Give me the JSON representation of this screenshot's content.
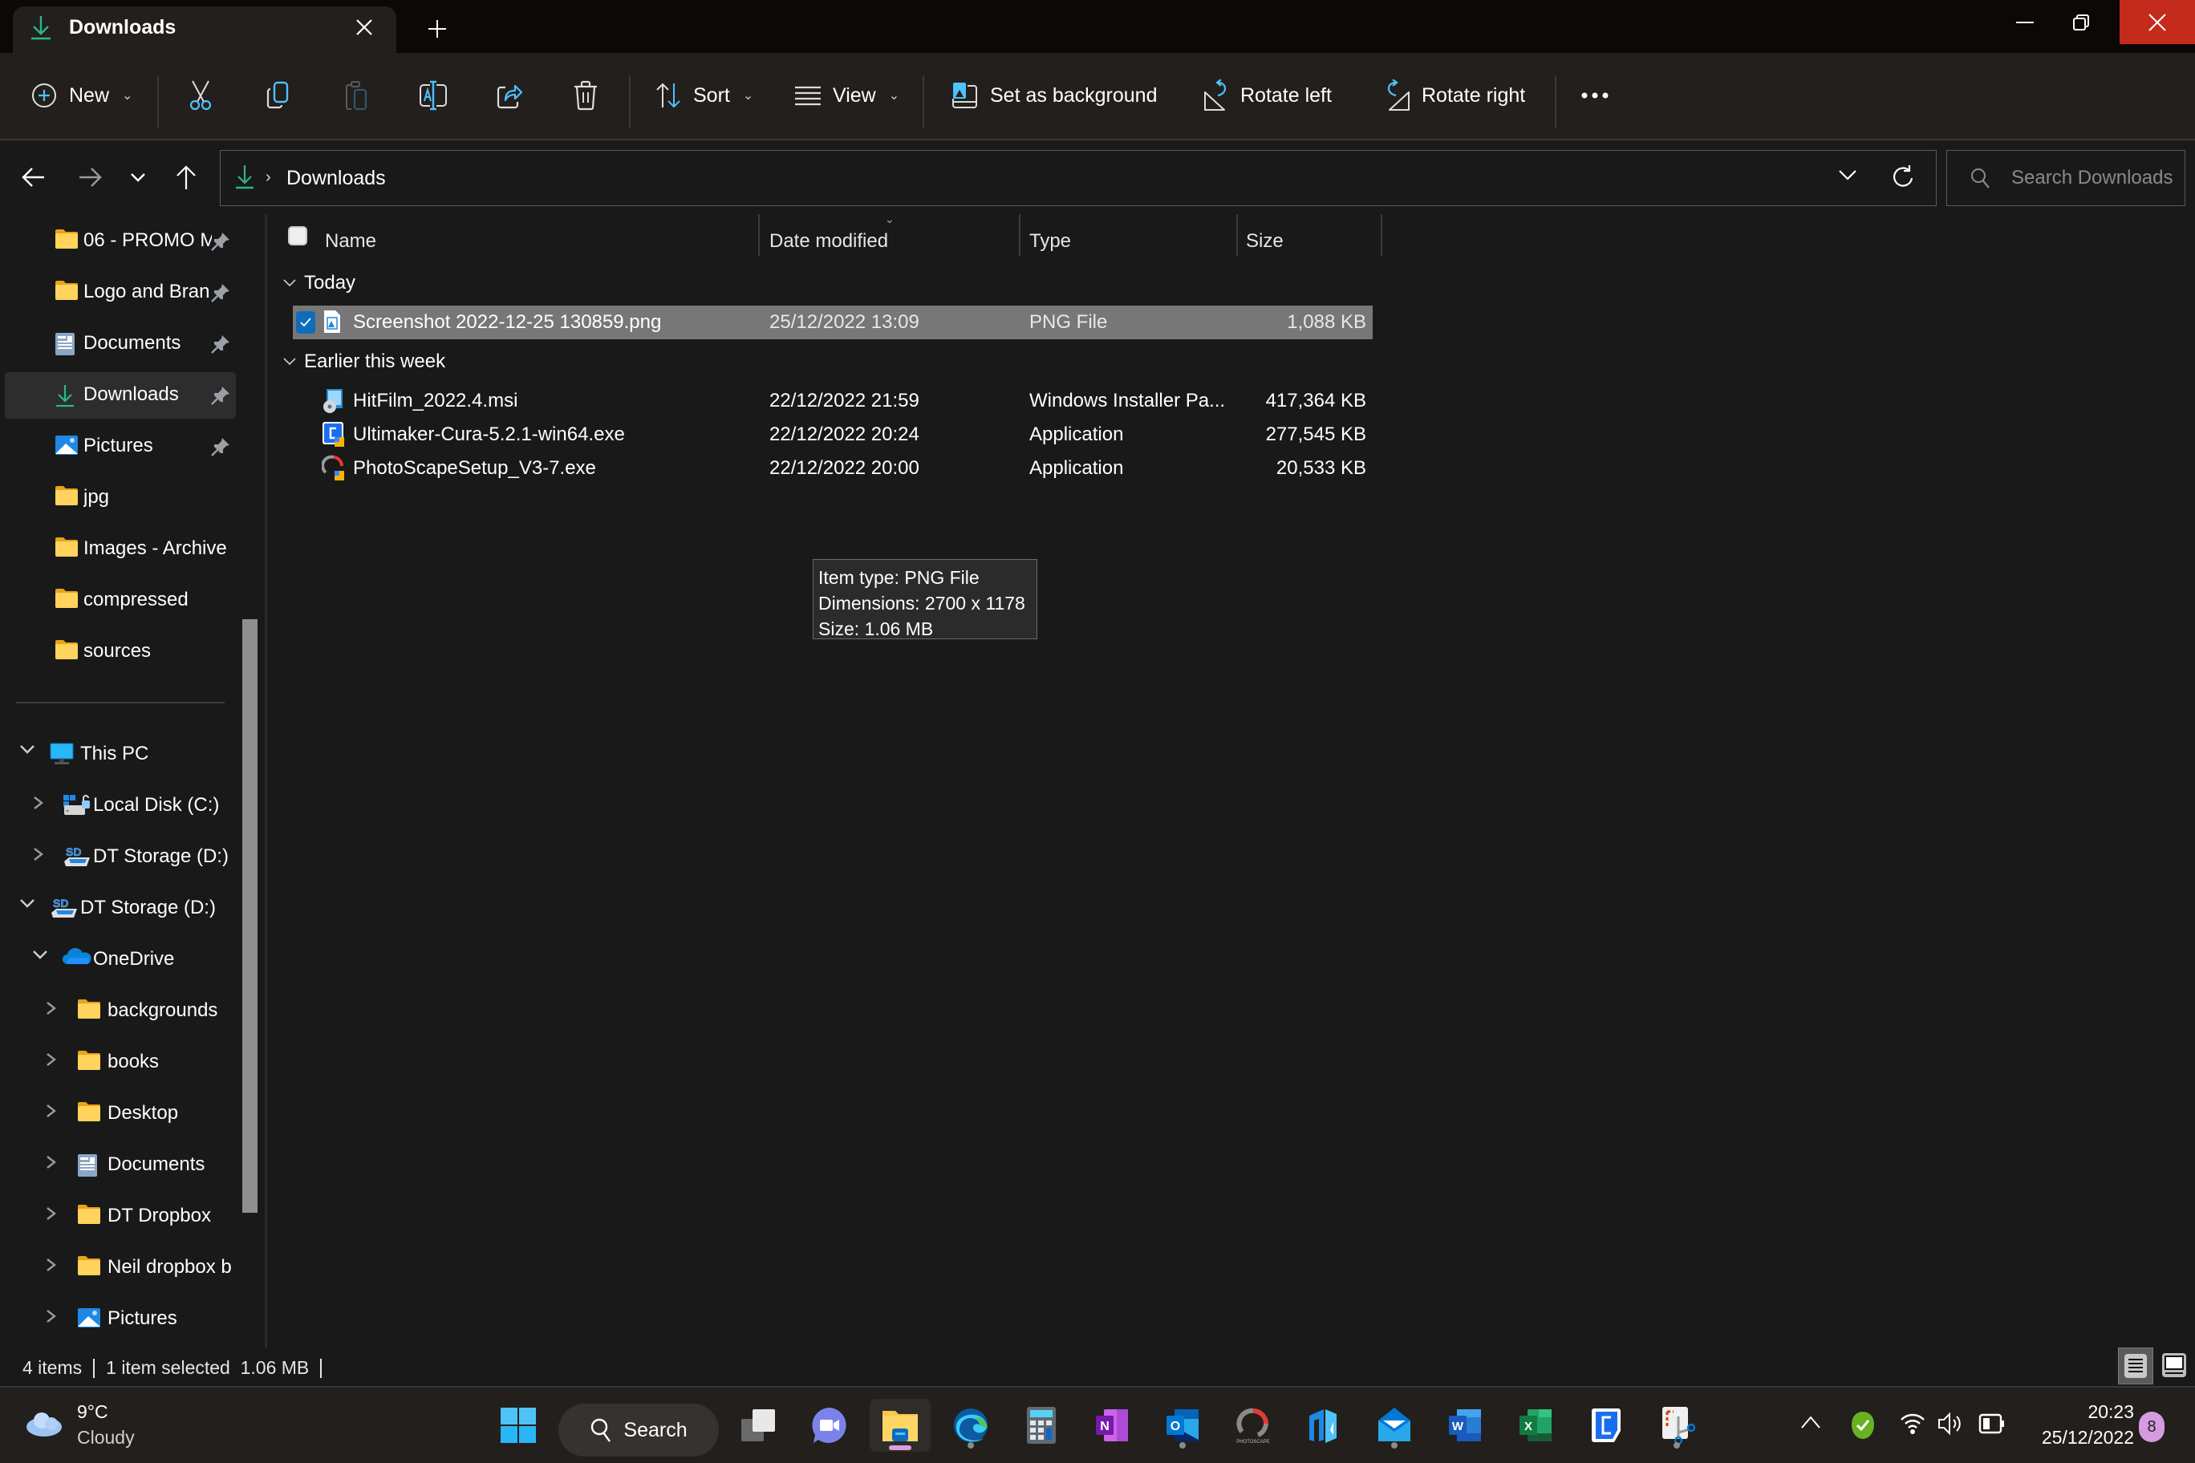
{
  "window": {
    "tab_title": "Downloads",
    "tab_icon": "download-icon",
    "new_tab_icon": "plus-icon",
    "minimize_icon": "minimize-icon",
    "maximize_icon": "restore-icon",
    "close_icon": "close-icon",
    "accent": "#2bb58a",
    "close_bg": "#c42b1c"
  },
  "toolbar": {
    "new_label": "New",
    "sort_label": "Sort",
    "view_label": "View",
    "set_background_label": "Set as background",
    "rotate_left_label": "Rotate left",
    "rotate_right_label": "Rotate right",
    "icons": [
      "add-circle-icon",
      "cut-icon",
      "copy-icon",
      "paste-icon",
      "rename-icon",
      "share-icon",
      "delete-icon",
      "sort-icon",
      "view-icon",
      "set-background-icon",
      "rotate-left-icon",
      "rotate-right-icon",
      "more-icon"
    ]
  },
  "address": {
    "breadcrumb": [
      "Downloads"
    ],
    "search_placeholder": "Search Downloads"
  },
  "sidebar": {
    "quick_access": [
      {
        "label": "06 - PROMO M",
        "icon": "folder-icon",
        "pinned": true
      },
      {
        "label": "Logo and Bran",
        "icon": "folder-icon",
        "pinned": true
      },
      {
        "label": "Documents",
        "icon": "documents-icon",
        "pinned": true
      },
      {
        "label": "Downloads",
        "icon": "download-icon",
        "pinned": true,
        "active": true
      },
      {
        "label": "Pictures",
        "icon": "pictures-icon",
        "pinned": true
      },
      {
        "label": "jpg",
        "icon": "folder-icon",
        "pinned": false
      },
      {
        "label": "Images - Archive",
        "icon": "folder-icon",
        "pinned": false
      },
      {
        "label": "compressed",
        "icon": "folder-icon",
        "pinned": false
      },
      {
        "label": "sources",
        "icon": "folder-icon",
        "pinned": false
      }
    ],
    "tree": [
      {
        "label": "This PC",
        "icon": "pc-icon",
        "expanded": true,
        "level": 0
      },
      {
        "label": "Local Disk (C:)",
        "icon": "drive-icon",
        "expanded": false,
        "level": 1
      },
      {
        "label": "DT Storage (D:)",
        "icon": "sd-drive-icon",
        "expanded": false,
        "level": 1
      },
      {
        "label": "DT Storage (D:)",
        "icon": "sd-drive-icon",
        "expanded": true,
        "level": 0
      },
      {
        "label": "OneDrive",
        "icon": "onedrive-icon",
        "expanded": true,
        "level": 1
      },
      {
        "label": "backgrounds",
        "icon": "folder-icon",
        "expanded": false,
        "level": 2
      },
      {
        "label": "books",
        "icon": "folder-icon",
        "expanded": false,
        "level": 2
      },
      {
        "label": "Desktop",
        "icon": "folder-icon",
        "expanded": false,
        "level": 2
      },
      {
        "label": "Documents",
        "icon": "documents-icon",
        "expanded": false,
        "level": 2
      },
      {
        "label": "DT Dropbox",
        "icon": "folder-icon",
        "expanded": false,
        "level": 2
      },
      {
        "label": "Neil dropbox b",
        "icon": "folder-icon",
        "expanded": false,
        "level": 2
      },
      {
        "label": "Pictures",
        "icon": "pictures-icon",
        "expanded": false,
        "level": 2
      }
    ]
  },
  "files": {
    "columns": [
      "Name",
      "Date modified",
      "Type",
      "Size"
    ],
    "groups": [
      {
        "label": "Today",
        "items": [
          {
            "name": "Screenshot 2022-12-25 130859.png",
            "date": "25/12/2022 13:09",
            "type": "PNG File",
            "size": "1,088 KB",
            "icon": "png-file-icon",
            "selected": true
          }
        ]
      },
      {
        "label": "Earlier this week",
        "items": [
          {
            "name": "HitFilm_2022.4.msi",
            "date": "22/12/2022 21:59",
            "type": "Windows Installer Pa...",
            "size": "417,364 KB",
            "icon": "msi-installer-icon",
            "selected": false
          },
          {
            "name": "Ultimaker-Cura-5.2.1-win64.exe",
            "date": "22/12/2022 20:24",
            "type": "Application",
            "size": "277,545 KB",
            "icon": "cura-app-icon",
            "selected": false
          },
          {
            "name": "PhotoScapeSetup_V3-7.exe",
            "date": "22/12/2022 20:00",
            "type": "Application",
            "size": "20,533 KB",
            "icon": "photoscape-app-icon",
            "selected": false
          }
        ]
      }
    ],
    "tooltip": {
      "line1": "Item type: PNG File",
      "line2": "Dimensions: 2700 x 1178",
      "line3": "Size: 1.06 MB"
    }
  },
  "status": {
    "item_count": "4 items",
    "selection": "1 item selected  1.06 MB"
  },
  "taskbar": {
    "weather_temp": "9°C",
    "weather_cond": "Cloudy",
    "search_label": "Search",
    "apps": [
      "start-icon",
      "search",
      "task-view-icon",
      "teams-chat-icon",
      "file-explorer-icon",
      "edge-icon",
      "calculator-icon",
      "onenote-icon",
      "outlook-icon",
      "photoscape-icon",
      "app-n-icon",
      "mail-icon",
      "word-icon",
      "excel-icon",
      "cura-icon",
      "snipping-tool-icon"
    ],
    "time": "20:23",
    "date": "25/12/2022",
    "notification_count": "8"
  }
}
